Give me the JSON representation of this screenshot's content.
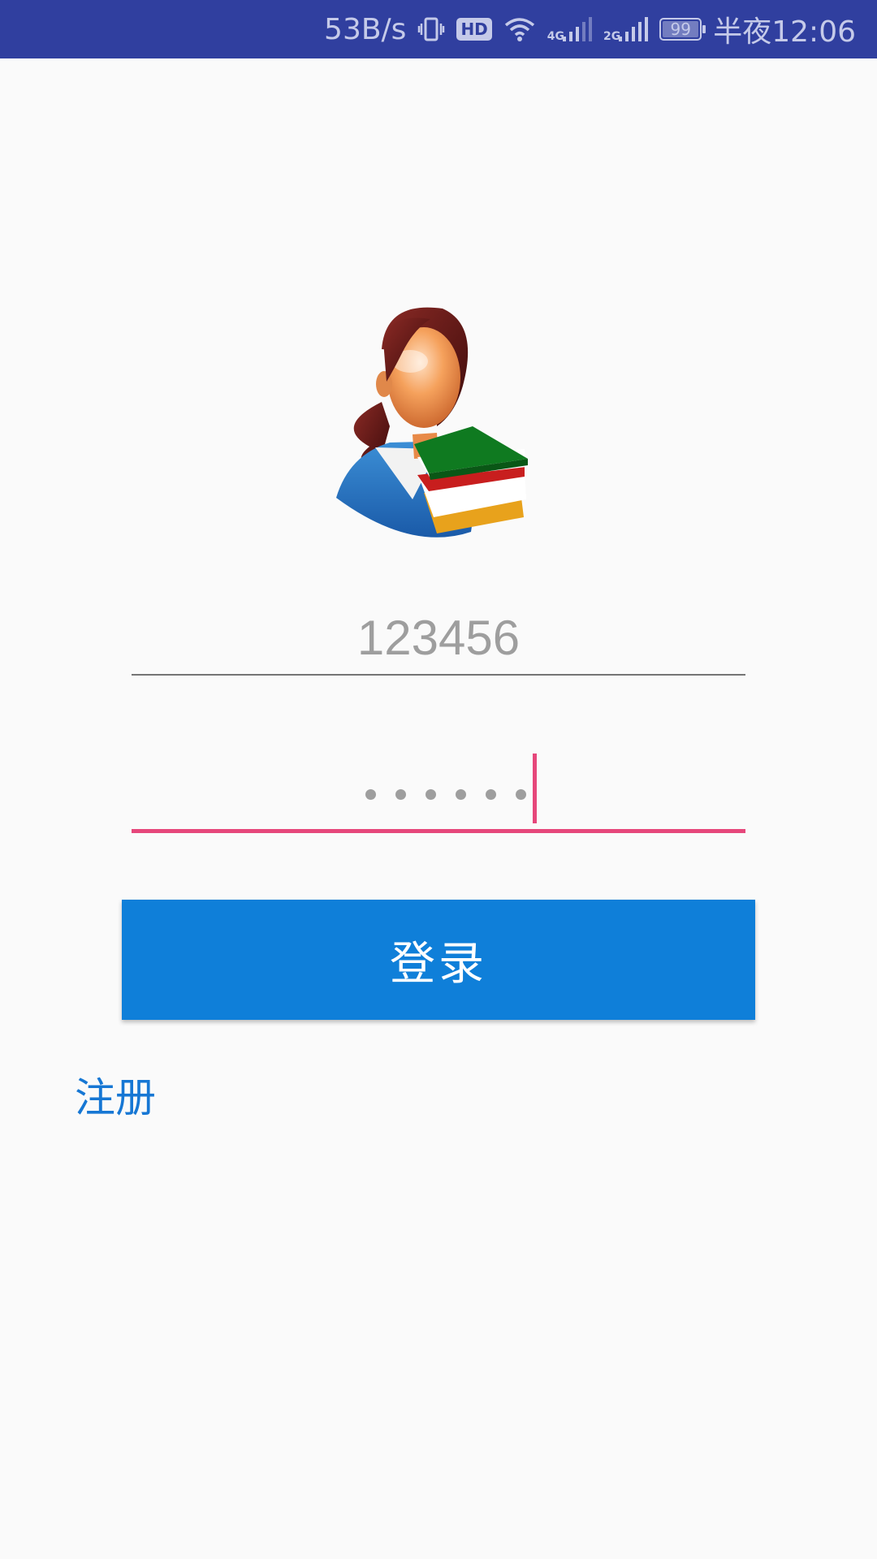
{
  "status_bar": {
    "net_speed": "53B/s",
    "hd_label": "HD",
    "net1_label": "4G",
    "net2_label": "2G",
    "battery_level": "99",
    "time": "半夜12:06",
    "icons": [
      "vibrate-icon",
      "hd-icon",
      "wifi-icon",
      "signal-4g-icon",
      "signal-2g-icon",
      "battery-icon"
    ],
    "colors": {
      "background": "#303f9f",
      "foreground": "#c5cae9"
    }
  },
  "app": {
    "avatar_icon": "teacher-with-books-avatar",
    "username": {
      "value": "123456"
    },
    "password": {
      "masked_length": 6,
      "focused": true
    },
    "login_label": "登录",
    "register_label": "注册",
    "colors": {
      "accent": "#e6477b",
      "primary_button": "#0f7fd9",
      "link": "#1677d4"
    }
  }
}
